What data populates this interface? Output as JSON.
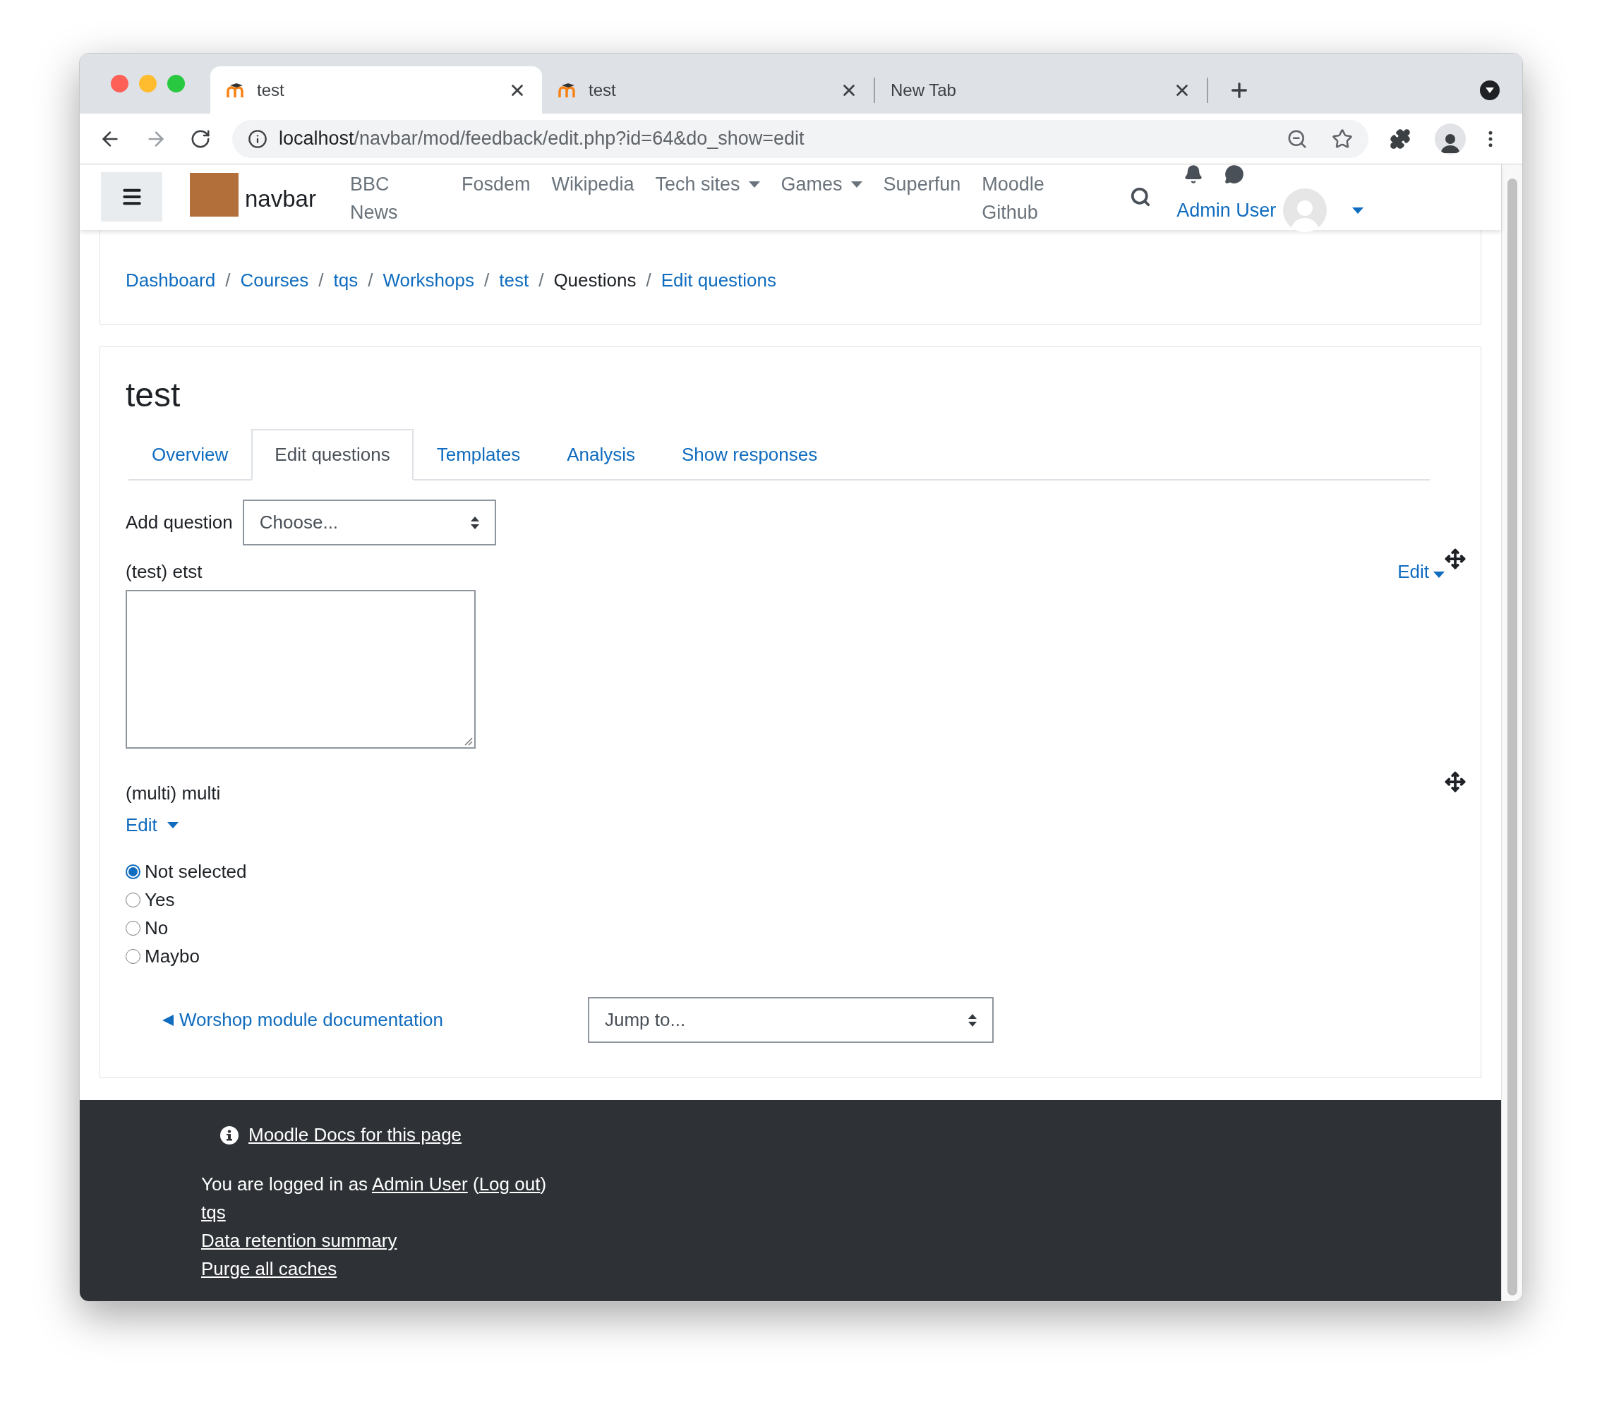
{
  "browser": {
    "tabs": [
      {
        "title": "test",
        "selected": true,
        "favicon": true
      },
      {
        "title": "test",
        "selected": false,
        "favicon": true
      },
      {
        "title": "New Tab",
        "selected": false,
        "favicon": false
      }
    ],
    "url_host": "localhost",
    "url_path": "/navbar/mod/feedback/edit.php?id=64&do_show=edit"
  },
  "navbar": {
    "brand": "navbar",
    "links": [
      {
        "label": "BBC News",
        "dropdown": false
      },
      {
        "label": "Fosdem",
        "dropdown": false
      },
      {
        "label": "Wikipedia",
        "dropdown": false
      },
      {
        "label": "Tech sites",
        "dropdown": true
      },
      {
        "label": "Games",
        "dropdown": true
      },
      {
        "label": "Superfun",
        "dropdown": false
      },
      {
        "label": "Moodle Github",
        "dropdown": false
      }
    ],
    "user": "Admin User"
  },
  "breadcrumb_separator": "/",
  "breadcrumb": [
    {
      "label": "Dashboard",
      "kind": "link"
    },
    {
      "label": "Courses",
      "kind": "link"
    },
    {
      "label": "tqs",
      "kind": "link"
    },
    {
      "label": "Workshops",
      "kind": "link"
    },
    {
      "label": "test",
      "kind": "link"
    },
    {
      "label": "Questions",
      "kind": "current"
    },
    {
      "label": "Edit questions",
      "kind": "link"
    }
  ],
  "heading": "test",
  "tabs": [
    {
      "label": "Overview",
      "selected": false
    },
    {
      "label": "Edit questions",
      "selected": true
    },
    {
      "label": "Templates",
      "selected": false
    },
    {
      "label": "Analysis",
      "selected": false
    },
    {
      "label": "Show responses",
      "selected": false
    }
  ],
  "add_question": {
    "label": "Add question",
    "placeholder": "Choose..."
  },
  "questions": [
    {
      "kind": "textarea",
      "label": "(test) etst",
      "edit": "Edit"
    },
    {
      "kind": "radio",
      "label": "(multi) multi",
      "edit": "Edit",
      "options": [
        {
          "label": "Not selected",
          "selected": true
        },
        {
          "label": "Yes",
          "selected": false
        },
        {
          "label": "No",
          "selected": false
        },
        {
          "label": "Maybo",
          "selected": false
        }
      ]
    }
  ],
  "activity_nav": {
    "prev_link": "Worshop module documentation",
    "jump": "Jump to..."
  },
  "footer": {
    "docs_link": "Moodle Docs for this page",
    "logged_in_prefix": "You are logged in as",
    "user": "Admin User",
    "paren_open": "(",
    "logout": "Log out",
    "paren_close": ")",
    "links": [
      "tqs",
      "Data retention summary",
      "Purge all caches"
    ]
  }
}
